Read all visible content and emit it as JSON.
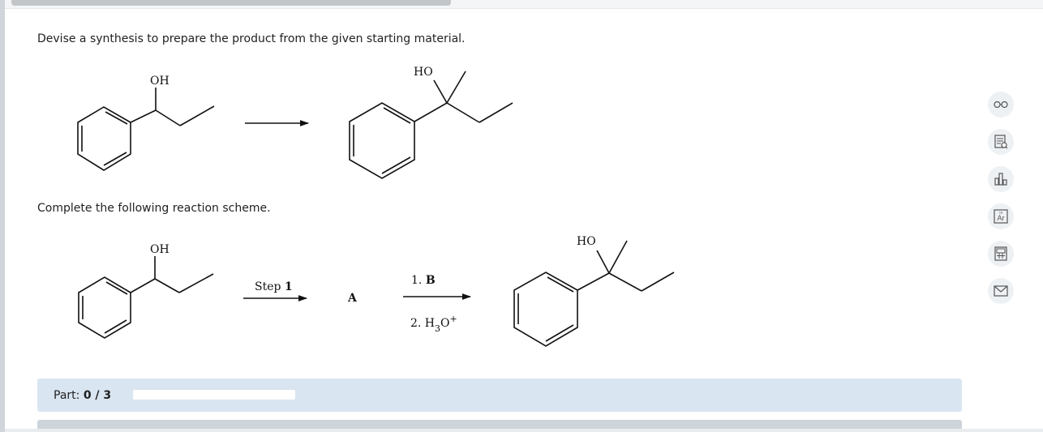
{
  "question": {
    "instruction": "Devise a synthesis to prepare the product from the given starting material.",
    "scheme_prompt": "Complete the following reaction scheme."
  },
  "molecules": {
    "start_oh": "OH",
    "product_ho": "HO"
  },
  "scheme": {
    "step_text": "Step ",
    "step_number": "1",
    "intermediate": "A",
    "reagent_1_prefix": "1. ",
    "reagent_1_letter": "B",
    "reagent_2_prefix": "2. H",
    "reagent_2_sub": "3",
    "reagent_2_suffix": "O",
    "reagent_2_sup": "+"
  },
  "part": {
    "label": "Part: ",
    "value": "0 / 3",
    "progress": 0
  },
  "tools": [
    "glasses-icon",
    "document-search-icon",
    "bar-chart-icon",
    "periodic-table-icon",
    "calculator-icon",
    "mail-icon"
  ]
}
